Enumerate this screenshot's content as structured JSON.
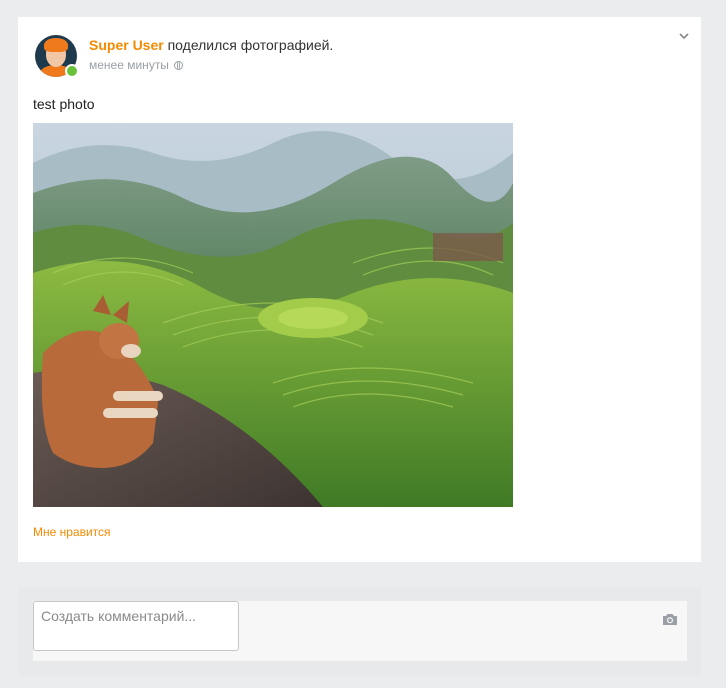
{
  "post": {
    "author_name": "Super User",
    "action_text": " поделился фотографией.",
    "time_text": "менее минуты",
    "body_text": "test photo",
    "like_label": "Мне нравится"
  },
  "comment": {
    "placeholder": "Создать комментарий..."
  },
  "icons": {
    "menu": "chevron-down-icon",
    "privacy": "globe-icon",
    "attach": "camera-icon"
  },
  "colors": {
    "accent": "#f58a00",
    "online": "#67c23a",
    "page_bg": "#eaeced"
  }
}
